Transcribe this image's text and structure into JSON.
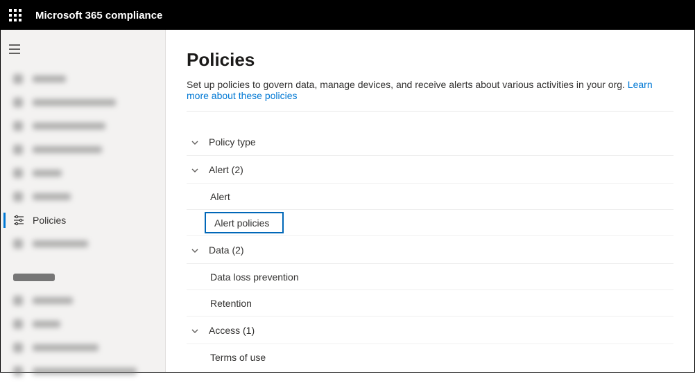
{
  "header": {
    "title": "Microsoft 365 compliance"
  },
  "sidebar": {
    "active_label": "Policies"
  },
  "page": {
    "title": "Policies",
    "description": "Set up policies to govern data, manage devices, and receive alerts about various activities in your org. ",
    "learn_more_label": "Learn more about these policies"
  },
  "groups": {
    "type_header": "Policy type",
    "sections": [
      {
        "label": "Alert (2)",
        "items": [
          {
            "label": "Alert"
          },
          {
            "label": "Alert policies",
            "highlight": true
          }
        ]
      },
      {
        "label": "Data (2)",
        "items": [
          {
            "label": "Data loss prevention"
          },
          {
            "label": "Retention"
          }
        ]
      },
      {
        "label": "Access (1)",
        "items": [
          {
            "label": "Terms of use"
          }
        ]
      }
    ]
  }
}
